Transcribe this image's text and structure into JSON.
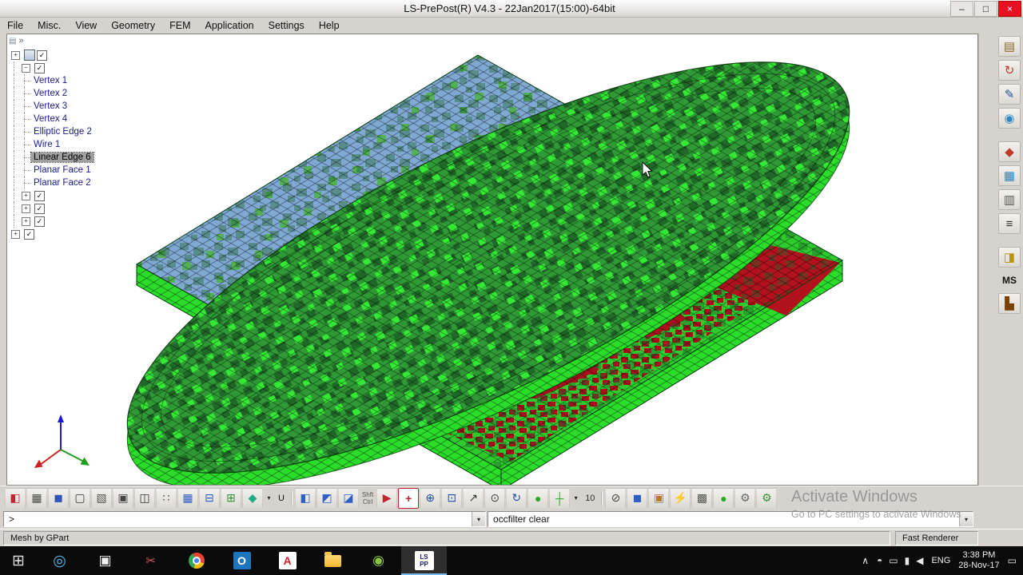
{
  "window": {
    "title": "LS-PrePost(R) V4.3 - 22Jan2017(15:00)-64bit",
    "minimize_glyph": "–",
    "maximize_glyph": "□",
    "close_glyph": "×"
  },
  "menubar": {
    "items": [
      "File",
      "Misc.",
      "View",
      "Geometry",
      "FEM",
      "Application",
      "Settings",
      "Help"
    ]
  },
  "top_strip": {
    "chevron": "»",
    "grip_glyph": "▤"
  },
  "tree": {
    "plus": "+",
    "minus": "−",
    "check": "✓",
    "items": [
      "Vertex 1",
      "Vertex 2",
      "Vertex 3",
      "Vertex 4",
      "Elliptic Edge 2",
      "Wire 1",
      "Linear Edge 6",
      "Planar Face 1",
      "Planar Face 2"
    ],
    "selected_item": "Linear Edge 6"
  },
  "viewport": {
    "colors": {
      "background": "#ffffff",
      "plate_green": "#2ecb2e",
      "edge_green": "#2bdc2b",
      "ellipse_green": "#2f9a35",
      "mesh_blue": "#7fa8d2",
      "result_red": "#b2121e",
      "mesh_line": "#000000"
    }
  },
  "right_toolbar": {
    "icons": [
      {
        "name": "doc-pages-icon",
        "glyph": "▤",
        "color": "#8a6d2f"
      },
      {
        "name": "refresh-icon",
        "glyph": "↻",
        "color": "#c0392b"
      },
      {
        "name": "annotate-pencil-icon",
        "glyph": "✎",
        "color": "#1f4e9c"
      },
      {
        "name": "globe-icon",
        "glyph": "◉",
        "color": "#2e86c1"
      },
      {
        "cls": "gap",
        "interactable": false
      },
      {
        "name": "probe-icon",
        "glyph": "◆",
        "color": "#c0392b"
      },
      {
        "name": "table-grid-icon",
        "glyph": "▦",
        "color": "#2e86c1"
      },
      {
        "name": "panel-icon",
        "glyph": "▥",
        "color": "#555555"
      },
      {
        "name": "list-icon",
        "glyph": "≡",
        "color": "#333333"
      },
      {
        "cls": "gap",
        "interactable": false
      },
      {
        "name": "highlight-icon",
        "glyph": "◨",
        "color": "#b7950b"
      },
      {
        "name": "ms-tool-label",
        "glyph": "MS",
        "cls": "txt"
      },
      {
        "name": "chart-icon",
        "glyph": "▙",
        "color": "#7b3f00"
      }
    ]
  },
  "bottom_toolbar": {
    "icons": [
      {
        "name": "clip-section-icon",
        "glyph": "◧",
        "color": "#c2252f"
      },
      {
        "name": "smooth-shade-icon",
        "glyph": "▦",
        "color": "#4a4a4a"
      },
      {
        "name": "flat-shade-icon",
        "glyph": "◼",
        "color": "#3355bb"
      },
      {
        "name": "wireframe-icon",
        "glyph": "▢",
        "color": "#333333"
      },
      {
        "name": "hidden-line-icon",
        "glyph": "▧",
        "color": "#555555"
      },
      {
        "name": "shade-edge-icon",
        "glyph": "▣",
        "color": "#444444"
      },
      {
        "name": "feature-line-icon",
        "glyph": "◫",
        "color": "#333333"
      },
      {
        "name": "node-display-icon",
        "glyph": "∷",
        "color": "#444444"
      },
      {
        "name": "mesh-display-icon",
        "glyph": "▦",
        "color": "#2e5fc4"
      },
      {
        "name": "shrink-element-icon",
        "glyph": "⊟",
        "color": "#2e5fc4"
      },
      {
        "name": "part-group-icon",
        "glyph": "⊞",
        "color": "#3a8f3a"
      },
      {
        "name": "material-gem-icon",
        "glyph": "◆",
        "color": "#1faa8a"
      },
      {
        "name": "gem-dropdown-icon",
        "glyph": "▾",
        "color": "#222222",
        "cls": "dd"
      },
      {
        "name": "undeform-toggle",
        "glyph": "U",
        "color": "#111111",
        "cls": "txt"
      },
      {
        "cls": "sep",
        "interactable": false
      },
      {
        "name": "view-front-icon",
        "glyph": "◧",
        "color": "#2e5fc4"
      },
      {
        "name": "view-top-icon",
        "glyph": "◩",
        "color": "#2e5fc4"
      },
      {
        "name": "view-iso-icon",
        "glyph": "◪",
        "color": "#2e5fc4"
      },
      {
        "name": "shift-ctrl-hint",
        "cls": "lines",
        "lines": [
          "Shft",
          "Ctrl"
        ],
        "interactable": false
      },
      {
        "name": "rotate-mode-icon",
        "glyph": "▶",
        "color": "#c2252f"
      },
      {
        "name": "pick-add-icon",
        "glyph": "+",
        "color": "#c2252f",
        "cls": "box"
      },
      {
        "name": "zoom-in-icon",
        "glyph": "⊕",
        "color": "#1f4e9c"
      },
      {
        "name": "zoom-window-icon",
        "glyph": "⊡",
        "color": "#1f4e9c"
      },
      {
        "name": "pick-arrow-icon",
        "glyph": "↗",
        "color": "#333333"
      },
      {
        "name": "center-view-icon",
        "glyph": "⊙",
        "color": "#444444"
      },
      {
        "name": "rotate-view-icon",
        "glyph": "↻",
        "color": "#1f4e9c"
      },
      {
        "name": "sphere-mode-icon",
        "glyph": "●",
        "color": "#2aa82a"
      },
      {
        "name": "axis-toggle-icon",
        "glyph": "┼",
        "color": "#2aa82a"
      },
      {
        "name": "angle-dropdown-icon",
        "glyph": "▾",
        "color": "#222222",
        "cls": "dd"
      },
      {
        "name": "angle-value",
        "glyph": "10",
        "cls": "txt",
        "interactable": false
      },
      {
        "cls": "sep",
        "interactable": false
      },
      {
        "name": "measure-icon",
        "glyph": "⊘",
        "color": "#444444"
      },
      {
        "name": "model-box-icon",
        "glyph": "◼",
        "color": "#2e5fc4"
      },
      {
        "name": "snapshot-icon",
        "glyph": "▣",
        "color": "#c07820"
      },
      {
        "name": "anim-lightning-icon",
        "glyph": "⚡",
        "color": "#d9a400"
      },
      {
        "name": "checker-display-icon",
        "glyph": "▩",
        "color": "#555555"
      },
      {
        "name": "render-quality-icon",
        "glyph": "●",
        "color": "#2aa82a"
      },
      {
        "name": "settings-gear-icon",
        "glyph": "⚙",
        "color": "#666666"
      },
      {
        "name": "process-gear-icon",
        "glyph": "⚙",
        "color": "#3a8f3a"
      }
    ]
  },
  "command_bar": {
    "prompt": ">",
    "history_value": "occfilter clear",
    "dropdown_glyph": "▾"
  },
  "status_bar": {
    "left": "Mesh by GPart",
    "right": "Fast Renderer"
  },
  "watermark": {
    "line1": "Activate Windows",
    "line2": "Go to PC settings to activate Windows"
  },
  "taskbar": {
    "start_glyph": "⊞",
    "search_glyph": "◎",
    "taskview_glyph": "▣",
    "snip_glyph": "✂",
    "outlook_label": "O",
    "acrobat_label": "A",
    "notes_glyph": "◉",
    "lspp_line1": "LS",
    "lspp_line2": "PP",
    "tray_chevron": "∧",
    "tray_icons": [
      {
        "name": "tray-status-icon",
        "glyph": "◓"
      },
      {
        "name": "tray-display-icon",
        "glyph": "▭"
      },
      {
        "name": "tray-battery-icon",
        "glyph": "▮"
      },
      {
        "name": "tray-volume-icon",
        "glyph": "◀"
      }
    ],
    "lang": "ENG",
    "time": "3:38 PM",
    "date": "28-Nov-17",
    "action_glyph": "▭"
  }
}
